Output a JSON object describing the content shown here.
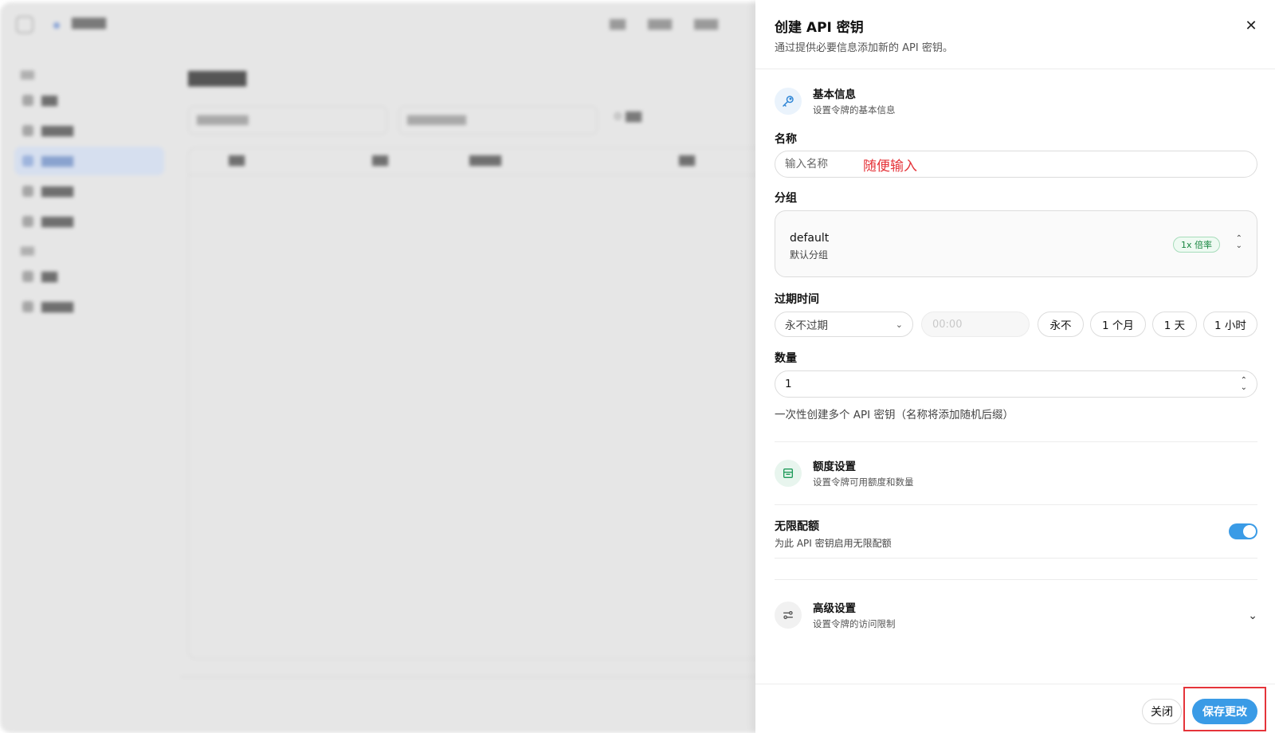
{
  "sheet": {
    "title": "创建 API 密钥",
    "subtitle": "通过提供必要信息添加新的 API 密钥。",
    "close_icon": "close-icon"
  },
  "basic_section": {
    "title": "基本信息",
    "subtitle": "设置令牌的基本信息",
    "icon": "key-icon"
  },
  "name_field": {
    "label": "名称",
    "placeholder": "输入名称",
    "value": "",
    "annotation": "随便输入",
    "annotation_color": "#e5343a"
  },
  "group_field": {
    "label": "分组",
    "selected_name": "default",
    "selected_desc": "默认分组",
    "rate_badge": "1x 倍率"
  },
  "expire_field": {
    "label": "过期时间",
    "selected": "永不过期",
    "time_placeholder": "00:00",
    "presets": [
      "永不",
      "1 个月",
      "1 天",
      "1 小时"
    ]
  },
  "quantity_field": {
    "label": "数量",
    "value": "1",
    "hint": "一次性创建多个 API 密钥（名称将添加随机后缀）"
  },
  "quota_section": {
    "title": "额度设置",
    "subtitle": "设置令牌可用额度和数量",
    "icon": "wallet-icon"
  },
  "unlimited_quota": {
    "label": "无限配额",
    "description": "为此 API 密钥启用无限配额",
    "enabled": true
  },
  "advanced_section": {
    "title": "高级设置",
    "subtitle": "设置令牌的访问限制",
    "icon": "sliders-icon"
  },
  "footer": {
    "close_label": "关闭",
    "save_label": "保存更改"
  },
  "colors": {
    "accent": "#3a9be6",
    "highlight": "#e5343a",
    "badge_green": "#16853f"
  }
}
